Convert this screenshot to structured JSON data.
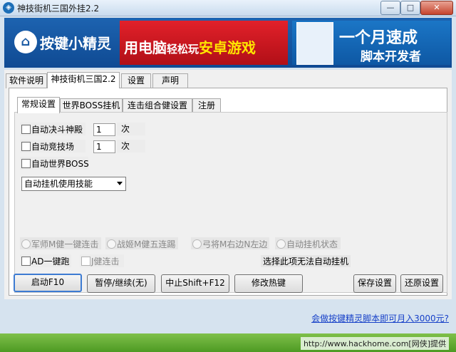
{
  "window": {
    "title": "神技街机三国外挂2.2",
    "controls": [
      "—",
      "□",
      "✕"
    ]
  },
  "banner": {
    "logo_text": "按键小精灵",
    "ad1_prefix": "用电脑",
    "ad1_mid": "轻松玩",
    "ad1_suffix": "安卓游戏",
    "ad2_big": "一个月速成",
    "ad2_sub": "脚本开发者"
  },
  "main_tabs": [
    "软件说明",
    "神技街机三国2.2",
    "设置",
    "声明"
  ],
  "sub_tabs": [
    "常规设置",
    "世界BOSS挂机",
    "连击组合健设置",
    "注册"
  ],
  "options": {
    "auto_duel_label": "自动决斗神殿",
    "auto_duel_count": "1",
    "auto_arena_label": "自动竞技场",
    "auto_arena_count": "1",
    "times_label": "次",
    "world_boss_label": "自动世界BOSS",
    "skill_select_value": "自动挂机使用技能"
  },
  "radios": [
    "军师M健一键连击",
    "战姬M健五连踢",
    "弓将M右边N左边",
    "自动挂机状态"
  ],
  "checks2": {
    "ad_label": "AD一键跑",
    "j_label": "J健连击"
  },
  "notice": "选择此项无法自动挂机",
  "buttons": {
    "start": "启动F10",
    "pause": "暂停/继续(无)",
    "stop": "中止Shift+F12",
    "hotkey": "修改热键",
    "save": "保存设置",
    "restore": "还原设置"
  },
  "footer": {
    "link": "会做按键精灵脚本即可月入3000元?",
    "status": "http://www.hackhome.com[网侠]提供"
  }
}
